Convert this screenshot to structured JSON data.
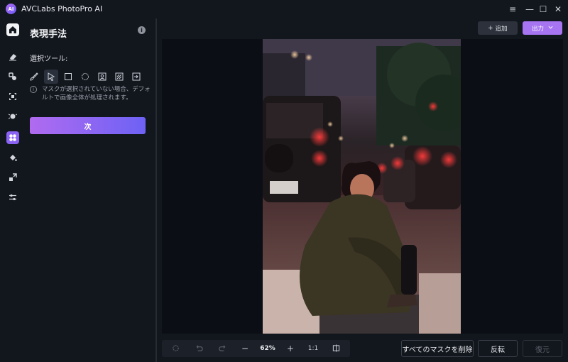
{
  "app": {
    "title": "AVCLabs PhotoPro AI",
    "logo_text": "AI"
  },
  "window_controls": [
    {
      "name": "menu-icon",
      "glyph": "≡"
    },
    {
      "name": "minimize-icon",
      "glyph": "—"
    },
    {
      "name": "maximize-icon",
      "glyph": "☐"
    },
    {
      "name": "close-icon",
      "glyph": "✕"
    }
  ],
  "rail": {
    "items": [
      {
        "name": "home-icon",
        "state": "home"
      },
      {
        "name": "eraser-icon",
        "state": "normal"
      },
      {
        "name": "object-replace-icon",
        "state": "normal"
      },
      {
        "name": "upscale-icon",
        "state": "normal"
      },
      {
        "name": "face-retouch-icon",
        "state": "normal"
      },
      {
        "name": "style-transfer-icon",
        "state": "active"
      },
      {
        "name": "colorize-icon",
        "state": "normal"
      },
      {
        "name": "expand-icon",
        "state": "normal"
      },
      {
        "name": "adjust-icon",
        "state": "normal"
      }
    ]
  },
  "panel": {
    "title": "表現手法",
    "selection_label": "選択ツール:",
    "hint": "マスクが選択されていない場合、デフォルトで画像全体が処理されます。",
    "next_button": "次",
    "tools": [
      {
        "name": "brush-tool-icon",
        "active": false
      },
      {
        "name": "select-pointer-tool-icon",
        "active": true
      },
      {
        "name": "rectangle-select-tool-icon",
        "active": false
      },
      {
        "name": "ellipse-select-tool-icon",
        "active": false
      },
      {
        "name": "portrait-select-tool-icon",
        "active": false
      },
      {
        "name": "auto-select-tool-icon",
        "active": false
      },
      {
        "name": "import-mask-tool-icon",
        "active": false
      }
    ]
  },
  "header_actions": {
    "add_label": "追加",
    "add_prefix": "+",
    "export_label": "出力",
    "export_suffix": "⌄"
  },
  "bottom_toolbar": {
    "zoom_value": "62%",
    "ratio_label": "1:1",
    "zoom_out": "−",
    "zoom_in": "+"
  },
  "actions": {
    "clear_masks": "すべてのマスクを削除",
    "invert": "反転",
    "restore": "復元"
  },
  "colors": {
    "accent": "#8a63f4",
    "gradient_start": "#b06bf0",
    "gradient_end": "#6d62f5",
    "background": "#12161d"
  }
}
